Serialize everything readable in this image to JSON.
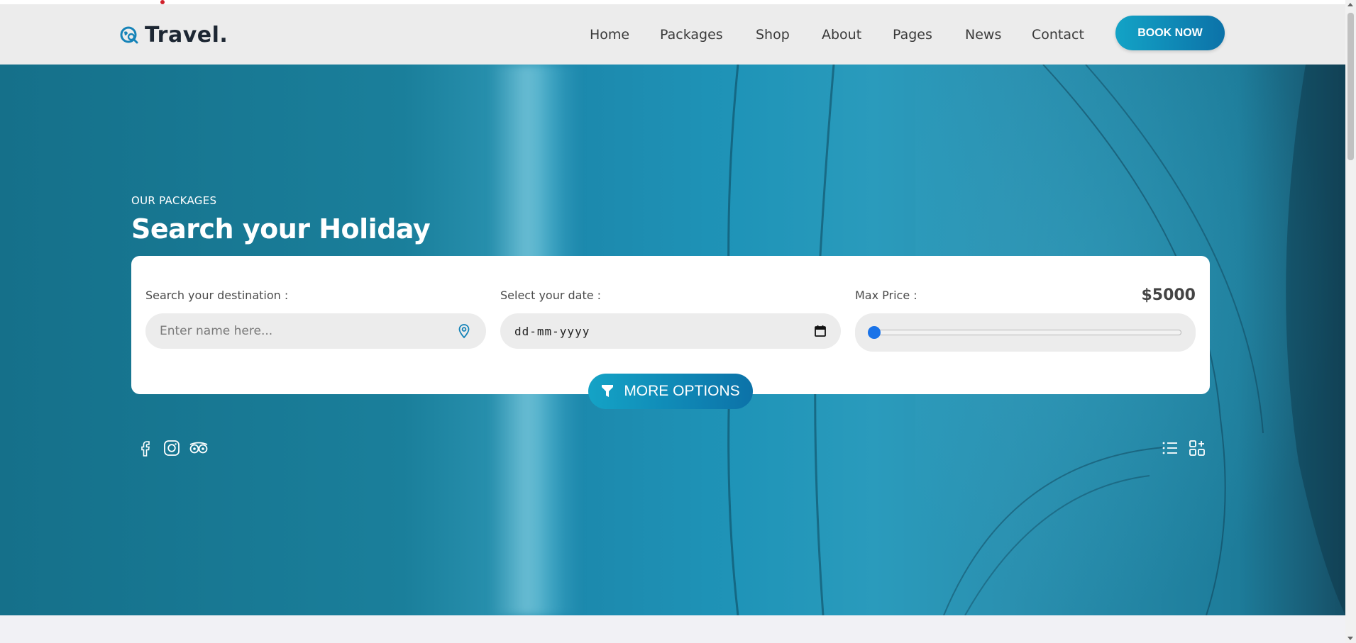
{
  "header": {
    "logo_text": "Travel.",
    "logo_icon": "globe-search-icon",
    "nav": [
      {
        "label": "Home"
      },
      {
        "label": "Packages"
      },
      {
        "label": "Shop"
      },
      {
        "label": "About"
      },
      {
        "label": "Pages"
      },
      {
        "label": "News"
      },
      {
        "label": "Contact"
      }
    ],
    "book_label": "BOOK NOW"
  },
  "hero": {
    "subtitle": "OUR PACKAGES",
    "title_prefix": "Search your",
    "title_highlight": "Holiday"
  },
  "search": {
    "destination_label": "Search your destination :",
    "destination_placeholder": "Enter name here...",
    "date_label": "Select your date :",
    "date_value": "dd-mm-yyyy",
    "price_label": "Max Price :",
    "price_value": "$5000",
    "price_slider_fraction": 0
  },
  "more_options_label": "MORE OPTIONS",
  "social_icons": [
    "facebook-icon",
    "instagram-icon",
    "tripadvisor-icon"
  ],
  "view_icons": [
    "list-view-icon",
    "grid-view-icon"
  ],
  "colors": {
    "accent_start": "#13a3c6",
    "accent_end": "#0c72a8",
    "header_bg": "#ececec",
    "slider_thumb": "#1a73e8"
  }
}
